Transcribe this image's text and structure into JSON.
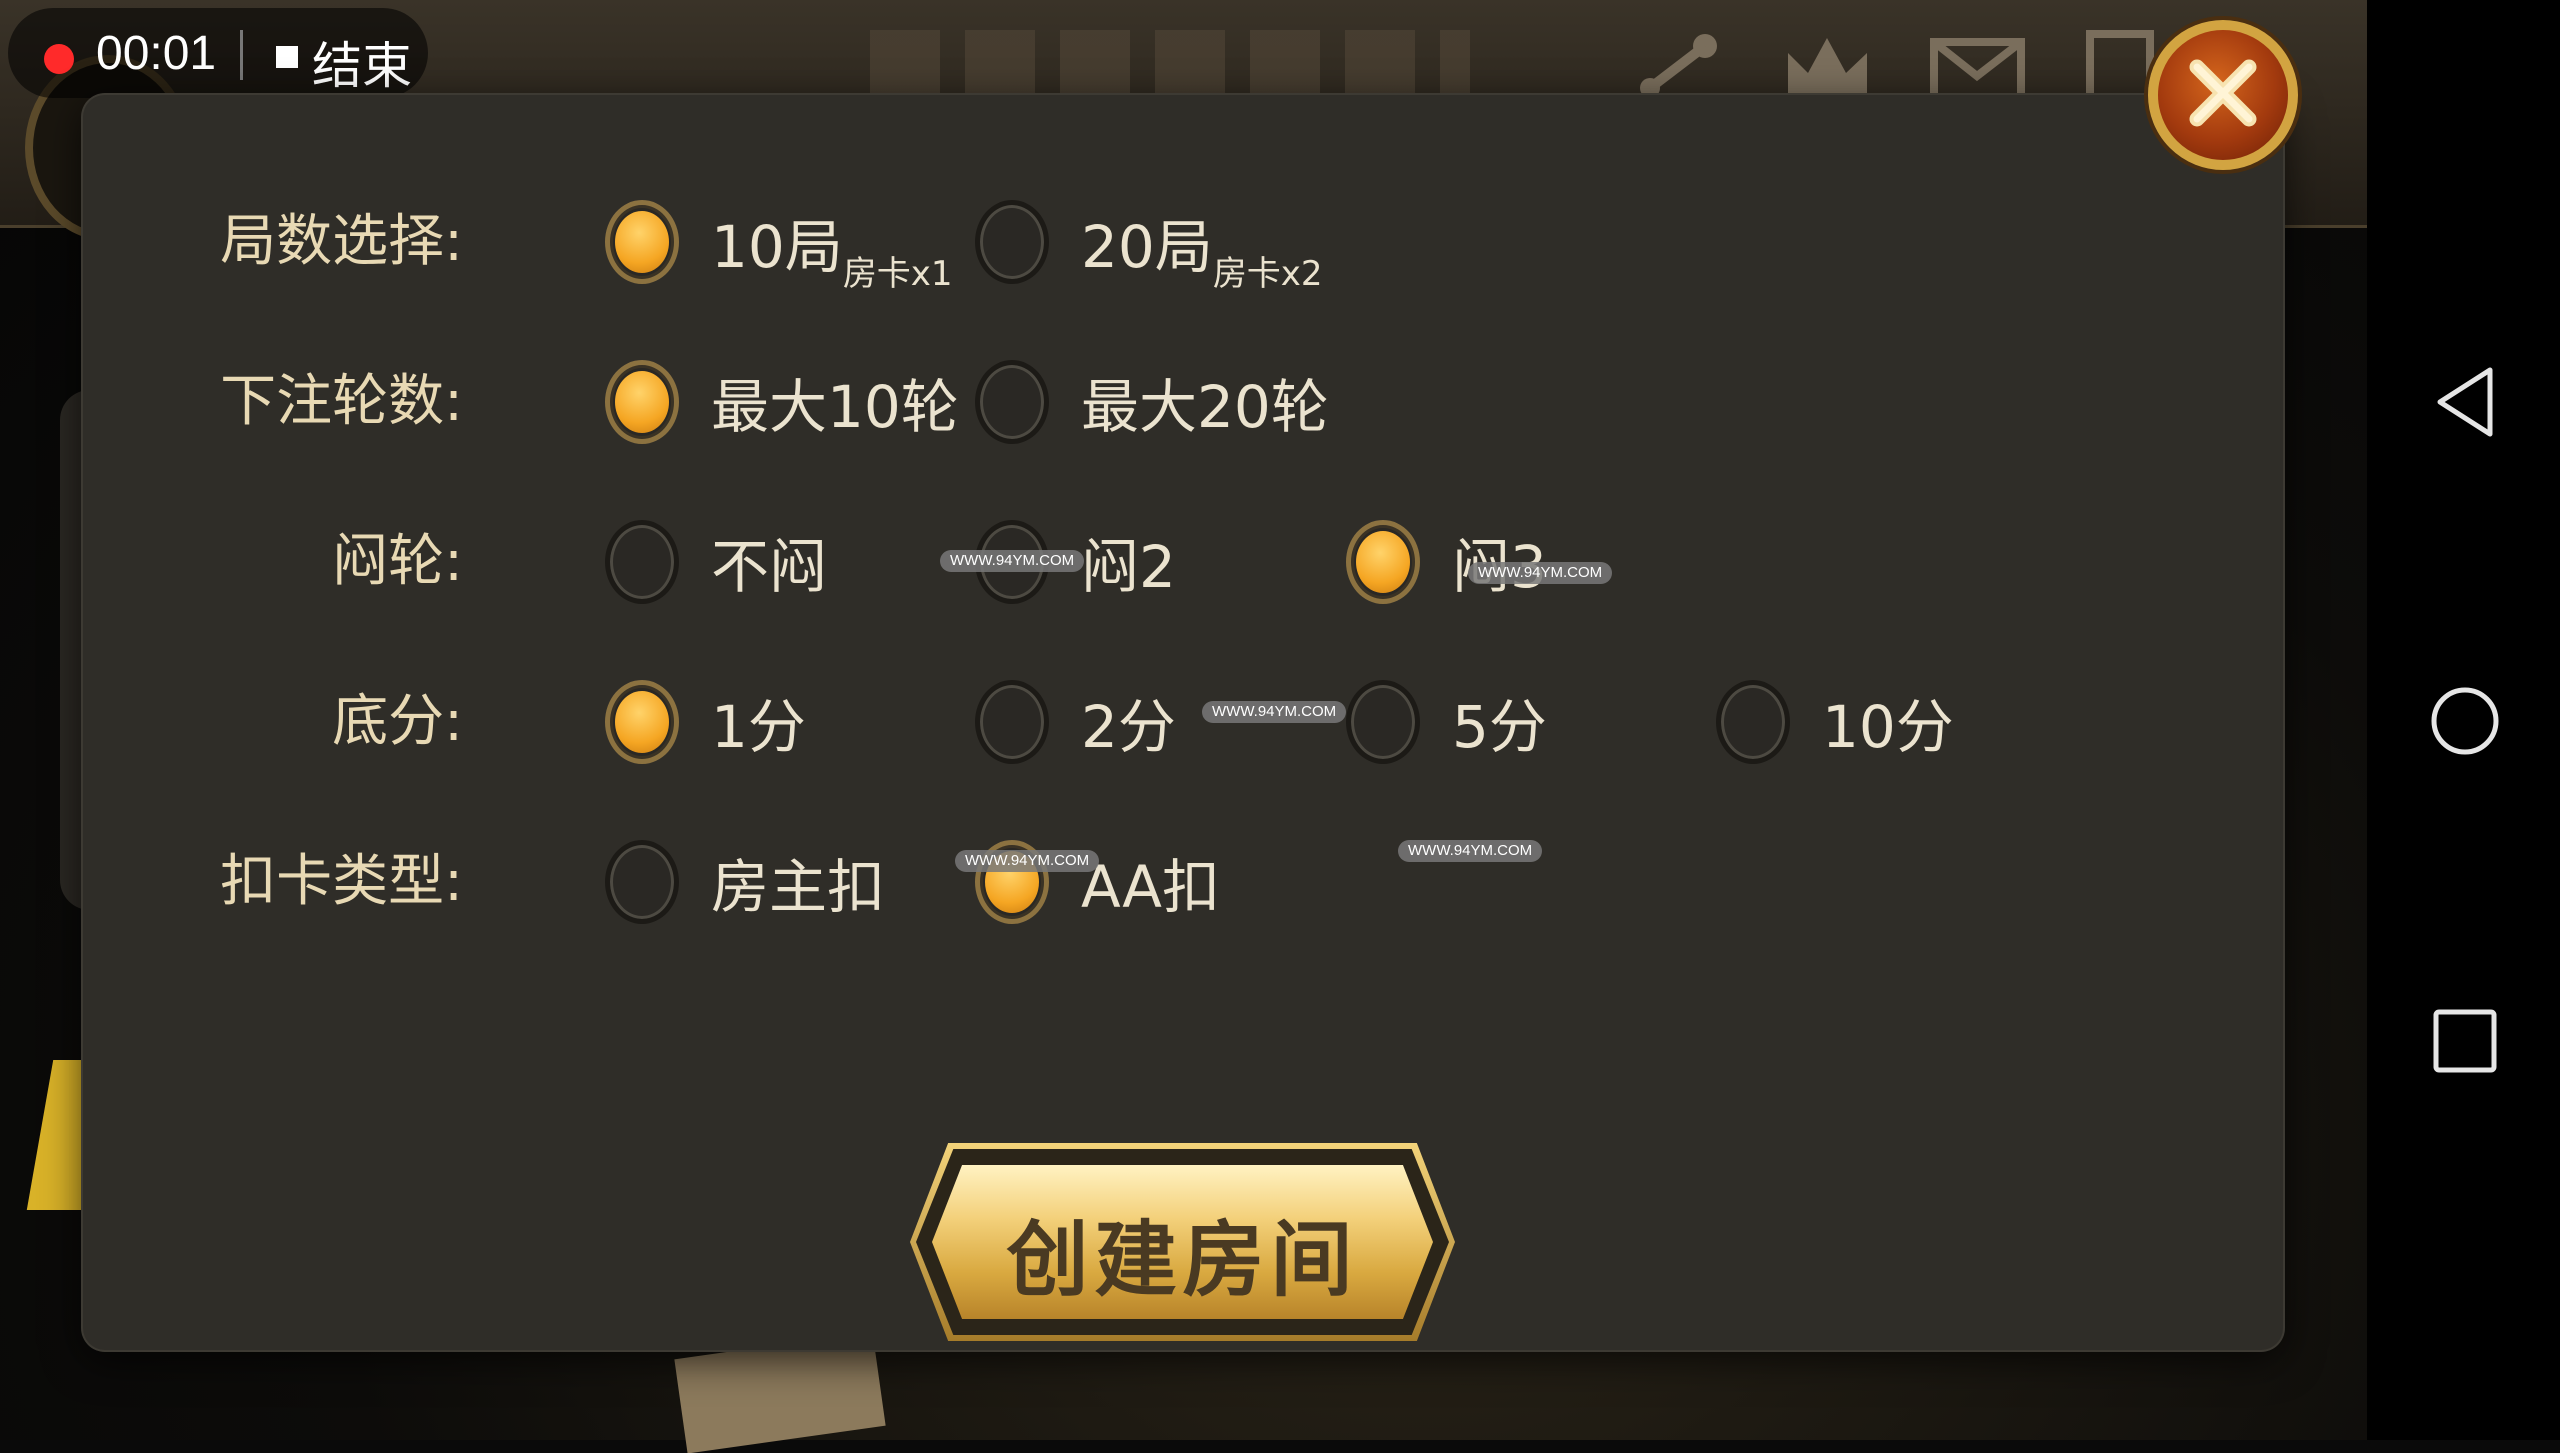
{
  "recording": {
    "time": "00:01",
    "stop_label": "结束"
  },
  "dialog": {
    "rows": [
      {
        "label": "局数选择:",
        "options": [
          {
            "text": "10局",
            "sub": "房卡x1",
            "selected": true
          },
          {
            "text": "20局",
            "sub": "房卡x2",
            "selected": false
          }
        ]
      },
      {
        "label": "下注轮数:",
        "options": [
          {
            "text": "最大10轮",
            "selected": true
          },
          {
            "text": "最大20轮",
            "selected": false
          }
        ]
      },
      {
        "label": "闷轮:",
        "options": [
          {
            "text": "不闷",
            "selected": false
          },
          {
            "text": "闷2",
            "selected": false
          },
          {
            "text": "闷3",
            "selected": true
          }
        ]
      },
      {
        "label": "底分:",
        "options": [
          {
            "text": "1分",
            "selected": true
          },
          {
            "text": "2分",
            "selected": false
          },
          {
            "text": "5分",
            "selected": false
          },
          {
            "text": "10分",
            "selected": false
          }
        ]
      },
      {
        "label": "扣卡类型:",
        "options": [
          {
            "text": "房主扣",
            "selected": false
          },
          {
            "text": "AA扣",
            "selected": true
          }
        ]
      }
    ],
    "create_button_label": "创建房间"
  },
  "watermark_text": "WWW.94YM.COM",
  "colors": {
    "accent": "#f5a623",
    "panel": "#2f2d28",
    "label": "#e8d9b4"
  }
}
